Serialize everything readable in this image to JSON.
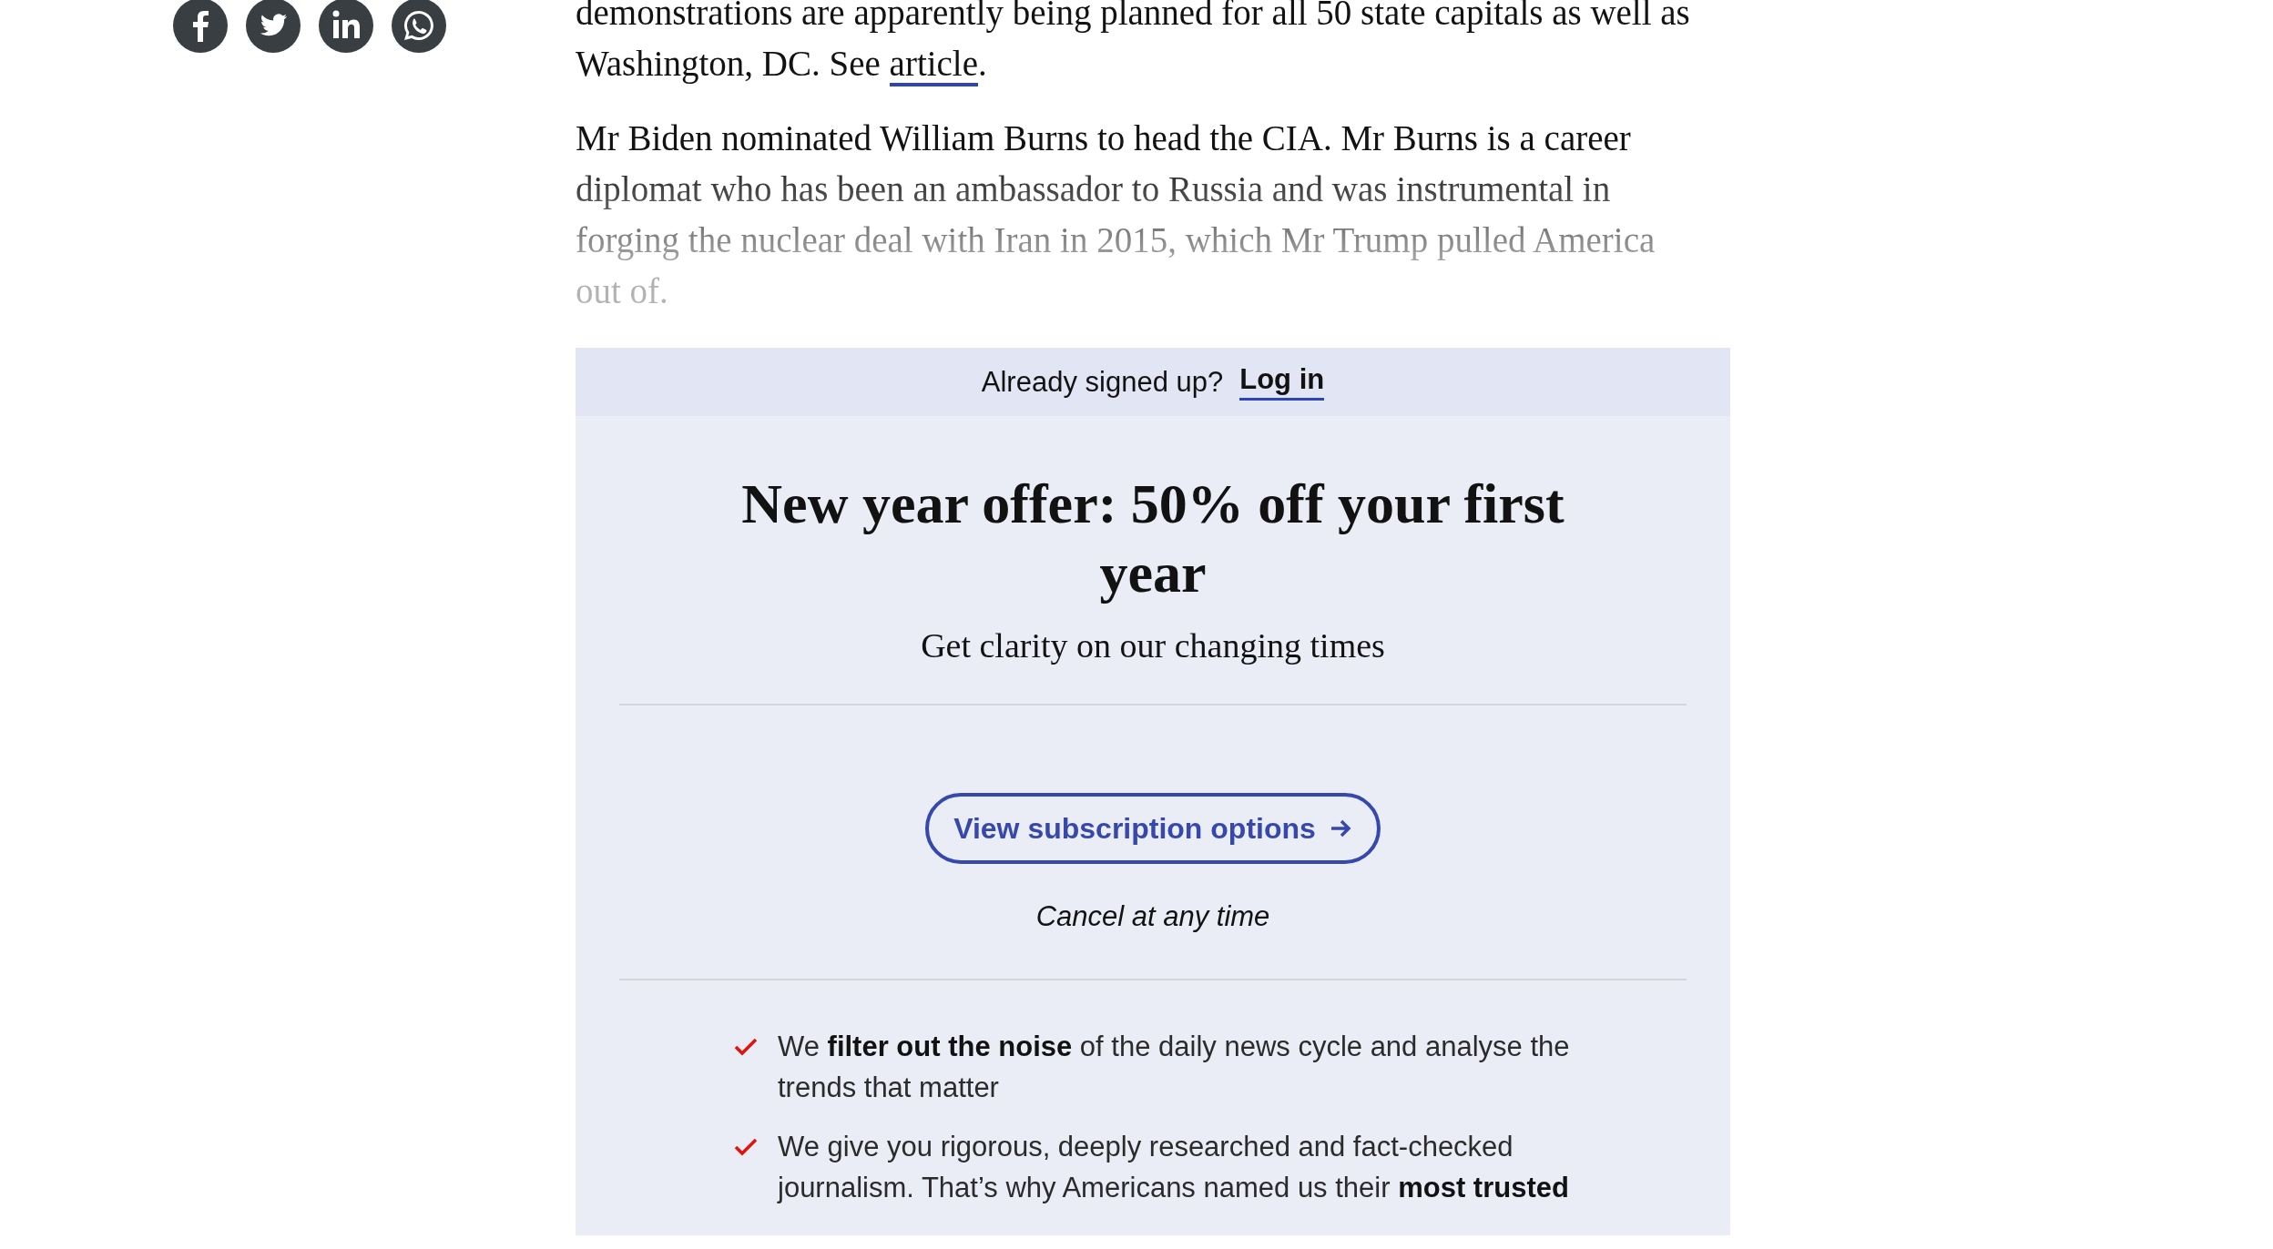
{
  "article": {
    "paragraphs": [
      {
        "text": "demonstrations are apparently being planned for all 50 state capitals as well as Washington, DC. See ",
        "link": "article",
        "after": "."
      },
      {
        "text": "Mr Biden nominated William Burns to head the CIA. Mr Burns is a career diplomat who has been an ambassador to Russia and was instrumental in forging the nuclear deal with Iran in 2015, which Mr Trump pulled America out of."
      }
    ]
  },
  "paywall": {
    "login_prompt": "Already signed up?",
    "login_link": "Log in",
    "headline": "New year offer: 50% off your first year",
    "subtitle": "Get clarity on our changing times",
    "button": "View subscription options",
    "note": "Cancel at any time",
    "benefits": [
      "We **filter out the noise** of the daily news cycle and analyse the trends that matter",
      "We give you rigorous, deeply researched and fact-checked journalism. That’s why Americans named us their **most trusted**"
    ]
  }
}
